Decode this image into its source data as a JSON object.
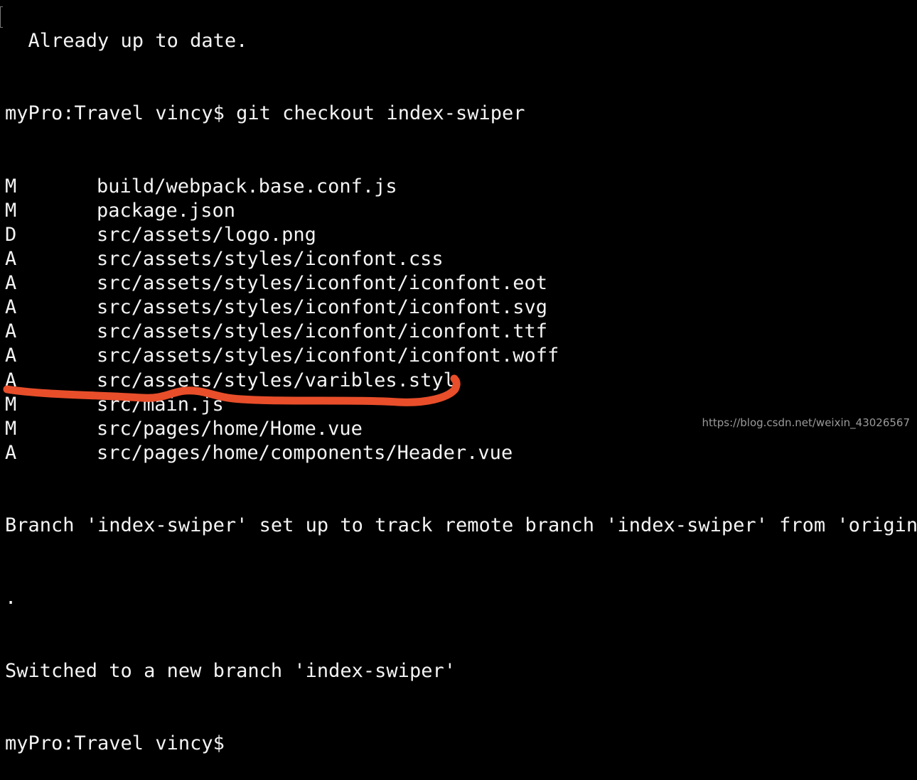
{
  "terminal": {
    "cut_line": "  Already up to date.",
    "prompt": "myPro:Travel vincy$",
    "command": "git checkout index-swiper",
    "changes": [
      {
        "status": "M",
        "path": "build/webpack.base.conf.js"
      },
      {
        "status": "M",
        "path": "package.json"
      },
      {
        "status": "D",
        "path": "src/assets/logo.png"
      },
      {
        "status": "A",
        "path": "src/assets/styles/iconfont.css"
      },
      {
        "status": "A",
        "path": "src/assets/styles/iconfont/iconfont.eot"
      },
      {
        "status": "A",
        "path": "src/assets/styles/iconfont/iconfont.svg"
      },
      {
        "status": "A",
        "path": "src/assets/styles/iconfont/iconfont.ttf"
      },
      {
        "status": "A",
        "path": "src/assets/styles/iconfont/iconfont.woff"
      },
      {
        "status": "A",
        "path": "src/assets/styles/varibles.styl"
      },
      {
        "status": "M",
        "path": "src/main.js"
      },
      {
        "status": "M",
        "path": "src/pages/home/Home.vue"
      },
      {
        "status": "A",
        "path": "src/pages/home/components/Header.vue"
      }
    ],
    "branch_msg": "Branch 'index-swiper' set up to track remote branch 'index-swiper' from 'origin'",
    "branch_msg_end": ".",
    "switched_msg": "Switched to a new branch 'index-swiper'",
    "final_prompt": "myPro:Travel vincy$"
  },
  "annotation_color": "#e84e2a",
  "watermark": "https://blog.csdn.net/weixin_43026567"
}
